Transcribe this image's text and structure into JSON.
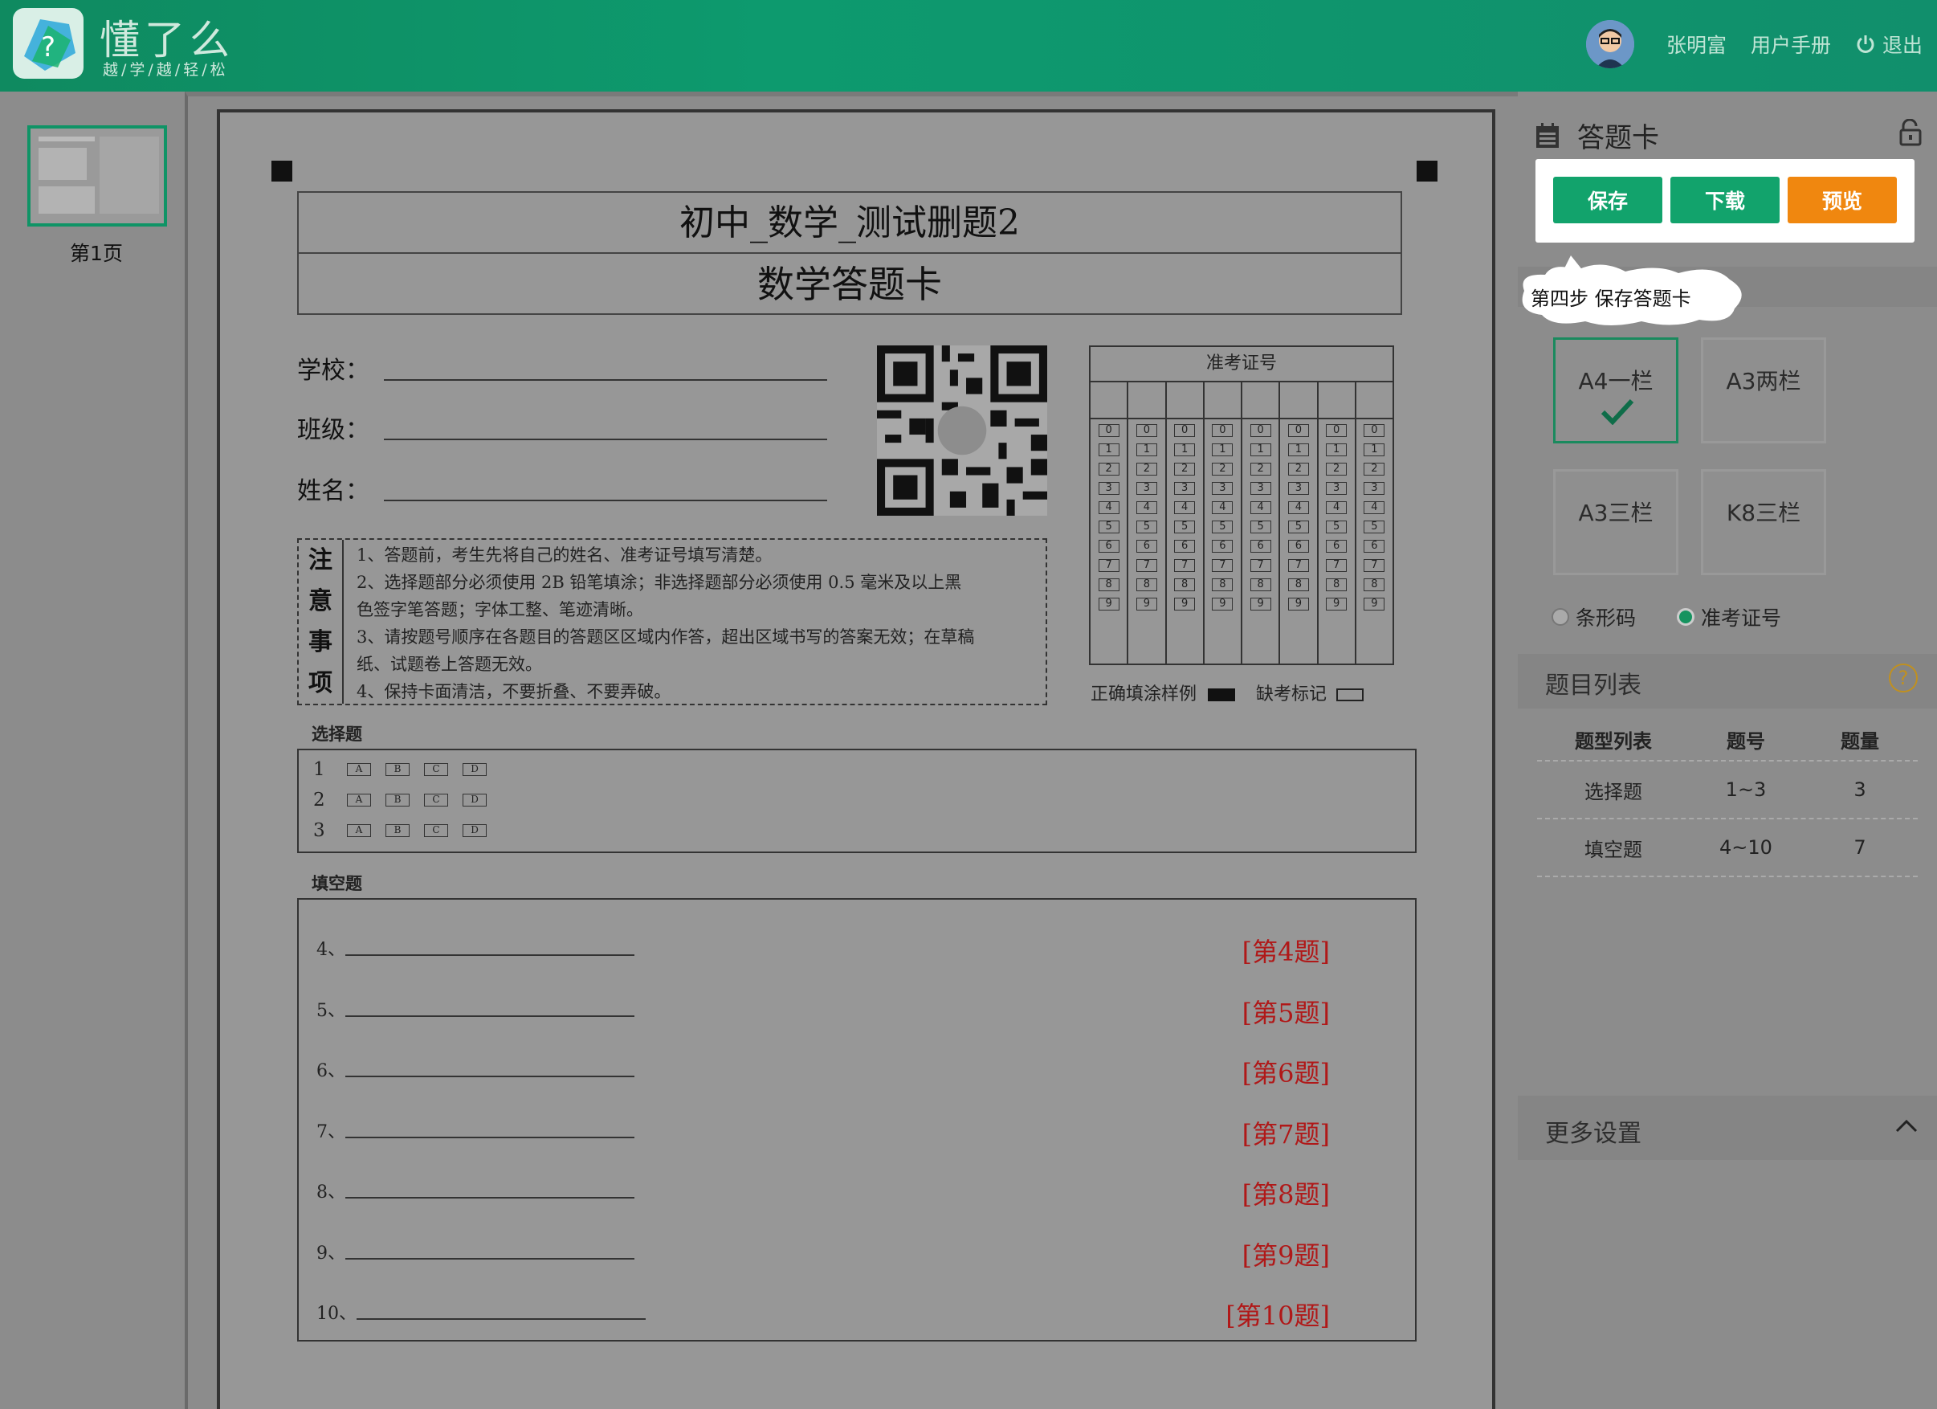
{
  "header": {
    "brand_name": "懂了么",
    "brand_slogan": "越/学/越/轻/松",
    "user_name": "张明富",
    "manual_link": "用户手册",
    "logout_label": "退出"
  },
  "sidebar": {
    "pages": [
      {
        "label": "第1页"
      }
    ]
  },
  "paper": {
    "title": "初中_数学_测试删题2",
    "subtitle": "数学答题卡",
    "fields": [
      {
        "label": "学校："
      },
      {
        "label": "班级："
      },
      {
        "label": "姓名："
      }
    ],
    "exam_id_title": "准考证号",
    "digits": [
      "0",
      "1",
      "2",
      "3",
      "4",
      "5",
      "6",
      "7",
      "8",
      "9"
    ],
    "legend_correct": "正确填涂样例",
    "legend_absent": "缺考标记",
    "notice_title": [
      "注",
      "意",
      "事",
      "项"
    ],
    "notice_lines": [
      "1、答题前，考生先将自己的姓名、准考证号填写清楚。",
      "2、选择题部分必须使用 2B 铅笔填涂；非选择题部分必须使用 0.5 毫米及以上黑",
      "色签字笔答题；字体工整、笔迹清晰。",
      "3、请按题号顺序在各题目的答题区区域内作答，超出区域书写的答案无效；在草稿",
      "纸、试题卷上答题无效。",
      "4、保持卡面清洁，不要折叠、不要弄破。"
    ],
    "choice_section": "选择题",
    "choice_rows": [
      {
        "num": "1",
        "options": [
          "A",
          "B",
          "C",
          "D"
        ]
      },
      {
        "num": "2",
        "options": [
          "A",
          "B",
          "C",
          "D"
        ]
      },
      {
        "num": "3",
        "options": [
          "A",
          "B",
          "C",
          "D"
        ]
      }
    ],
    "fill_section": "填空题",
    "fill_rows": [
      {
        "num": "4、",
        "tag": "[第4题]"
      },
      {
        "num": "5、",
        "tag": "[第5题]"
      },
      {
        "num": "6、",
        "tag": "[第6题]"
      },
      {
        "num": "7、",
        "tag": "[第7题]"
      },
      {
        "num": "8、",
        "tag": "[第8题]"
      },
      {
        "num": "9、",
        "tag": "[第9题]"
      },
      {
        "num": "10、",
        "tag": "[第10题]"
      }
    ]
  },
  "panel": {
    "title": "答题卡",
    "buttons": {
      "save": "保存",
      "download": "下载",
      "preview": "预览"
    },
    "tooltip": "第四步 保存答题卡",
    "layouts": [
      {
        "label": "A4一栏",
        "selected": true
      },
      {
        "label": "A3两栏",
        "selected": false
      },
      {
        "label": "A3三栏",
        "selected": false
      },
      {
        "label": "K8三栏",
        "selected": false
      }
    ],
    "id_modes": [
      {
        "label": "条形码",
        "selected": false
      },
      {
        "label": "准考证号",
        "selected": true
      }
    ],
    "question_list_title": "题目列表",
    "table_headers": [
      "题型列表",
      "题号",
      "题量"
    ],
    "table_rows": [
      [
        "选择题",
        "1~3",
        "3"
      ],
      [
        "填空题",
        "4~10",
        "7"
      ]
    ],
    "more_settings": "更多设置"
  },
  "colors": {
    "header": "#0f8a60",
    "save": "#12a36c",
    "download": "#12a36c",
    "preview": "#f0870f",
    "fill_tag": "#b01818"
  }
}
